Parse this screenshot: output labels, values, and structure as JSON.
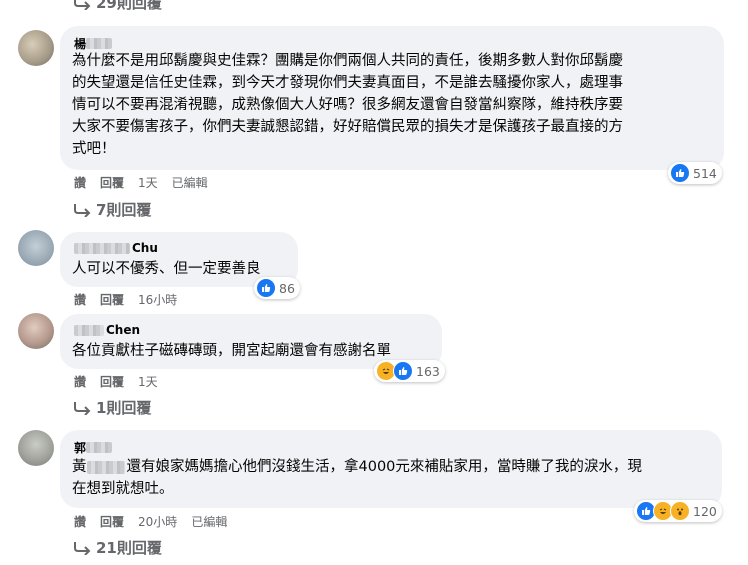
{
  "top_replies": {
    "label": "29則回覆"
  },
  "comments": [
    {
      "author_visible": "楊",
      "lines": [
        "為什麼不是用邱鬍慶與史佳霖？團購是你們兩個人共同的責任，後期多數人對你邱鬍慶",
        "的失望還是信任史佳霖，到今天才發現你們夫妻真面目，不是誰去騷擾你家人，處理事",
        "情可以不要再混淆視聽，成熟像個大人好嗎？很多網友還會自發當糾察隊，維持秩序要",
        "大家不要傷害孩子，你們夫妻誠懇認錯，好好賠償民眾的損失才是保護孩子最直接的方",
        "式吧！"
      ],
      "actions": [
        "讚",
        "回覆",
        "1天",
        "已編輯"
      ],
      "reactions": [
        "like"
      ],
      "count": "514",
      "replies": "7則回覆"
    },
    {
      "author_visible": "Chu",
      "lines": [
        "人可以不優秀、但一定要善良"
      ],
      "actions": [
        "讚",
        "回覆",
        "16小時"
      ],
      "reactions": [
        "like"
      ],
      "count": "86",
      "replies": ""
    },
    {
      "author_visible": "Chen",
      "lines": [
        "各位貢獻柱子磁磚磚頭，開宮起廟還會有感謝名單"
      ],
      "actions": [
        "讚",
        "回覆",
        "1天"
      ],
      "reactions": [
        "haha",
        "like"
      ],
      "count": "163",
      "replies": "1則回覆"
    },
    {
      "author_visible": "郭",
      "line1_prefix": "黃",
      "line1_rest": "還有娘家媽媽擔心他們沒錢生活，拿4000元來補貼家用，當時賺了我的淚水，現",
      "line2": "在想到就想吐。",
      "actions": [
        "讚",
        "回覆",
        "20小時",
        "已編輯"
      ],
      "reactions": [
        "like",
        "haha",
        "wow"
      ],
      "count": "120",
      "replies": "21則回覆"
    }
  ],
  "colors": {
    "bubble": "#f0f2f5",
    "meta": "#65676b",
    "like": "#1877f2",
    "emoji": "#f7b125"
  }
}
